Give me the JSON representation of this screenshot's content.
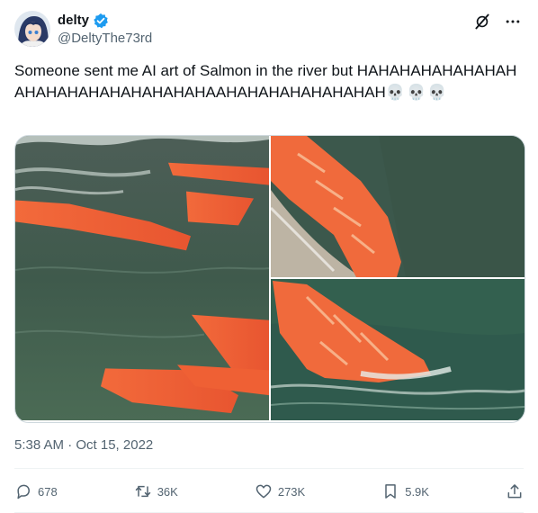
{
  "author": {
    "display_name": "delty",
    "handle": "@DeltyThe73rd",
    "verified": true
  },
  "top_actions": [
    "grok-icon",
    "more-icon"
  ],
  "tweet": {
    "text": "Someone sent me AI art of Salmon in the river but HAHAHAHAHAHAHAHAHAHAHAHAHAHAHAHAHAAHAHAHAHAHAHAHAH",
    "emojis": "💀💀💀"
  },
  "media": {
    "count": 3,
    "items": [
      "salmon-fillets-in-river",
      "salmon-fillet-splash",
      "salmon-fillet-swimming"
    ]
  },
  "timestamp": "5:38 AM · Oct 15, 2022",
  "stats": {
    "replies": "678",
    "reposts": "36K",
    "likes": "273K",
    "bookmarks": "5.9K"
  },
  "colors": {
    "text": "#0f1419",
    "secondary": "#536471",
    "verified": "#1d9bf0",
    "salmon": "#f0643a",
    "water": "#3e5a4e"
  }
}
